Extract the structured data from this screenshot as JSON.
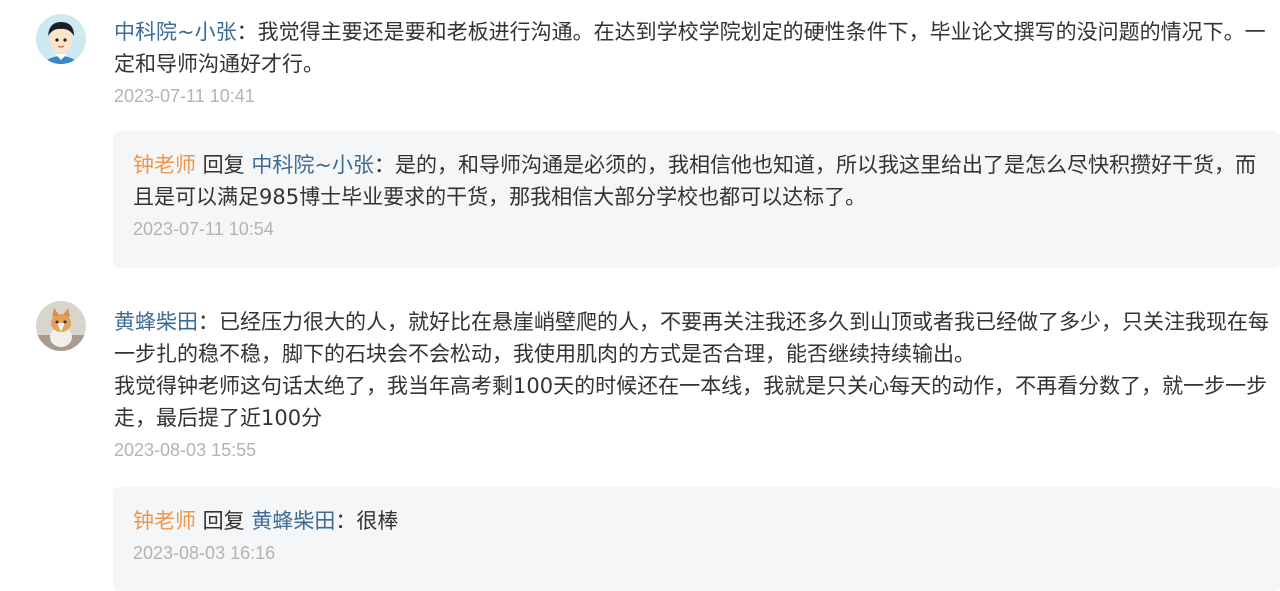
{
  "comments": [
    {
      "author": "中科院~小张",
      "separator": "：",
      "text": "我觉得主要还是要和老板进行沟通。在达到学校学院划定的硬性条件下，毕业论文撰写的没问题的情况下。一定和导师沟通好才行。",
      "time": "2023-07-11 10:41",
      "reply": {
        "author": "钟老师",
        "reply_word": " 回复 ",
        "target": "中科院~小张",
        "separator": "：",
        "text": "是的，和导师沟通是必须的，我相信他也知道，所以我这里给出了是怎么尽快积攒好干货，而且是可以满足985博士毕业要求的干货，那我相信大部分学校也都可以达标了。",
        "time": "2023-07-11 10:54"
      }
    },
    {
      "author": "黄蜂柴田",
      "separator": "：",
      "text": "已经压力很大的人，就好比在悬崖峭壁爬的人，不要再关注我还多久到山顶或者我已经做了多少，只关注我现在每一步扎的稳不稳，脚下的石块会不会松动，我使用肌肉的方式是否合理，能否继续持续输出。",
      "text2": "我觉得钟老师这句话太绝了，我当年高考剩100天的时候还在一本线，我就是只关心每天的动作，不再看分数了，就一步一步走，最后提了近100分",
      "time": "2023-08-03 15:55",
      "reply": {
        "author": "钟老师",
        "reply_word": " 回复 ",
        "target": "黄蜂柴田",
        "separator": "：",
        "text": "很棒",
        "time": "2023-08-03 16:16"
      }
    }
  ],
  "colors": {
    "username": "#3d6b96",
    "teacher": "#f0954a",
    "timestamp": "#b3b3b3",
    "reply_bg": "#f5f6f7"
  },
  "icons": [
    "cartoon-boy-avatar",
    "cat-avatar"
  ]
}
